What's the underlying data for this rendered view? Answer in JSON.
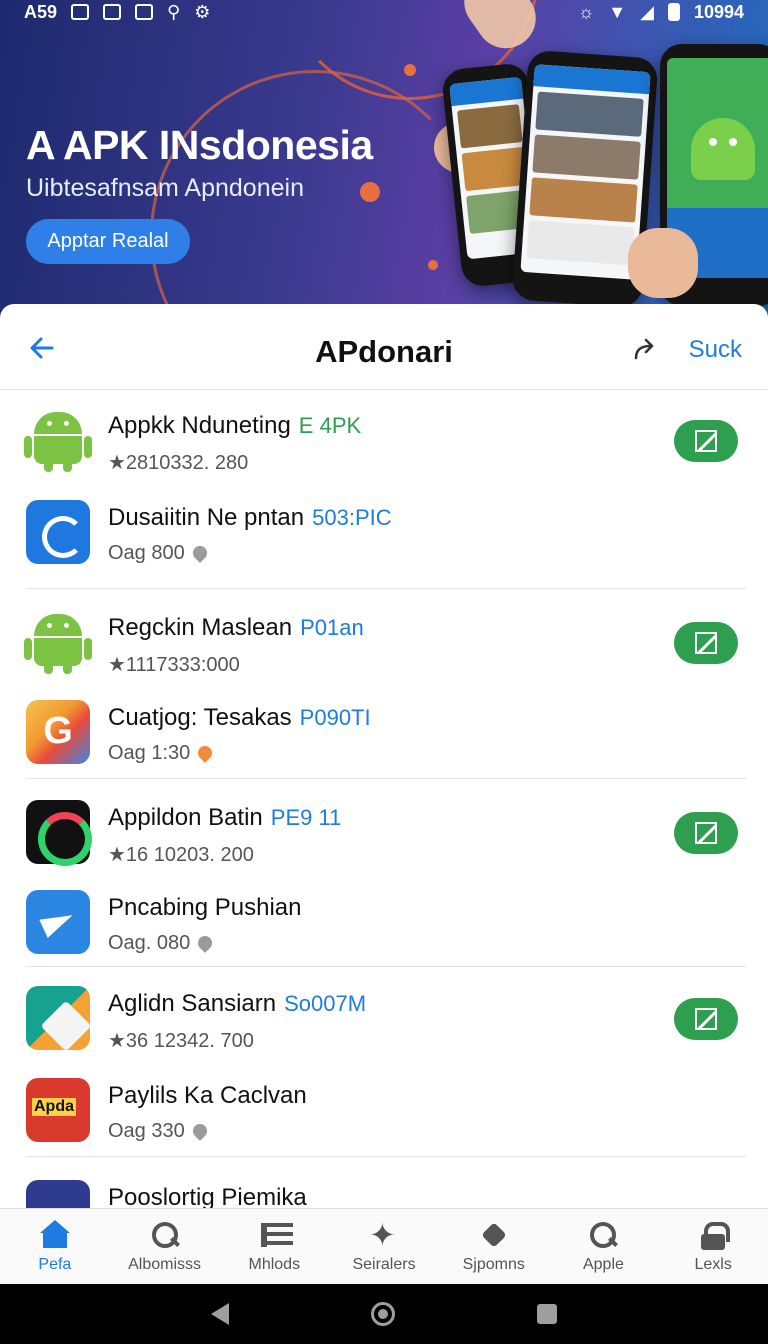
{
  "status_bar": {
    "left_text": "A59",
    "time": "10994",
    "icons": [
      "notification-icon",
      "message-icon",
      "screen-icon",
      "usb-icon",
      "settings-icon",
      "brightness-icon",
      "wifi-icon",
      "signal-icon",
      "battery-icon"
    ]
  },
  "hero": {
    "title": "A APK INsdonesia",
    "subtitle": "Uibtesafnsam Apndonein",
    "button_label": "Apptar Realal"
  },
  "topbar": {
    "title": "APdonari",
    "action_label": "Suck",
    "back_icon": "arrow-left-icon",
    "share_icon": "share-icon"
  },
  "apps": [
    {
      "name": "Appkk Nduneting",
      "tag": "E 4PK",
      "tag_color": "#2e9e4f",
      "meta": "★2810332. 280",
      "icon": "android",
      "toggle": true
    },
    {
      "name": "Dusaiitin Ne pntan",
      "tag": "503:PIC",
      "tag_color": "#1e7be0",
      "meta": "Oag 800",
      "icon": "blue-sync",
      "toggle": false,
      "pin_color": "#9a9a9a"
    },
    {
      "name": "Regckin Maslean",
      "tag": "P01an",
      "tag_color": "#1e7be0",
      "meta": "★1117333:000",
      "icon": "android",
      "toggle": true
    },
    {
      "name": "Cuatjog: Tesakas",
      "tag": "P090TI",
      "tag_color": "#1e7be0",
      "meta": "Oag 1:30",
      "icon": "google",
      "toggle": false,
      "pin_color": "#f08a3c"
    },
    {
      "name": "Appildon Batin",
      "tag": "PE9 11",
      "tag_color": "#1e7be0",
      "meta": "★16 10203. 200",
      "icon": "ring",
      "toggle": true
    },
    {
      "name": "Pncabing Pushian",
      "tag": "",
      "tag_color": "#1e7be0",
      "meta": "Oag. 080",
      "icon": "plane",
      "toggle": false,
      "pin_color": "#9a9a9a"
    },
    {
      "name": "Aglidn Sansiarn",
      "tag": "So007M",
      "tag_color": "#1e7be0",
      "meta": "★36 12342. 700",
      "icon": "docs",
      "toggle": true
    },
    {
      "name": "Paylils Ka Caclvan",
      "tag": "",
      "tag_color": "#1e7be0",
      "meta": "Oag 330",
      "icon": "red",
      "toggle": false,
      "pin_color": "#9a9a9a"
    },
    {
      "name": "Pooslortig Piemika",
      "tag": "",
      "tag_color": "#1e7be0",
      "meta": "",
      "icon": "purple",
      "toggle": false
    }
  ],
  "bottom_nav": [
    {
      "label": "Pefa",
      "icon": "home-icon",
      "active": true
    },
    {
      "label": "Albomisss",
      "icon": "search-icon",
      "active": false
    },
    {
      "label": "Mhlods",
      "icon": "list-icon",
      "active": false
    },
    {
      "label": "Seiralers",
      "icon": "star-icon",
      "active": false
    },
    {
      "label": "Sjpomns",
      "icon": "bug-icon",
      "active": false
    },
    {
      "label": "Apple",
      "icon": "search-icon",
      "active": false
    },
    {
      "label": "Lexls",
      "icon": "lock-icon",
      "active": false
    }
  ],
  "colors": {
    "accent": "#1e7be0",
    "toggle_green": "#2e9e4f",
    "hero_button": "#2f7fe8"
  }
}
